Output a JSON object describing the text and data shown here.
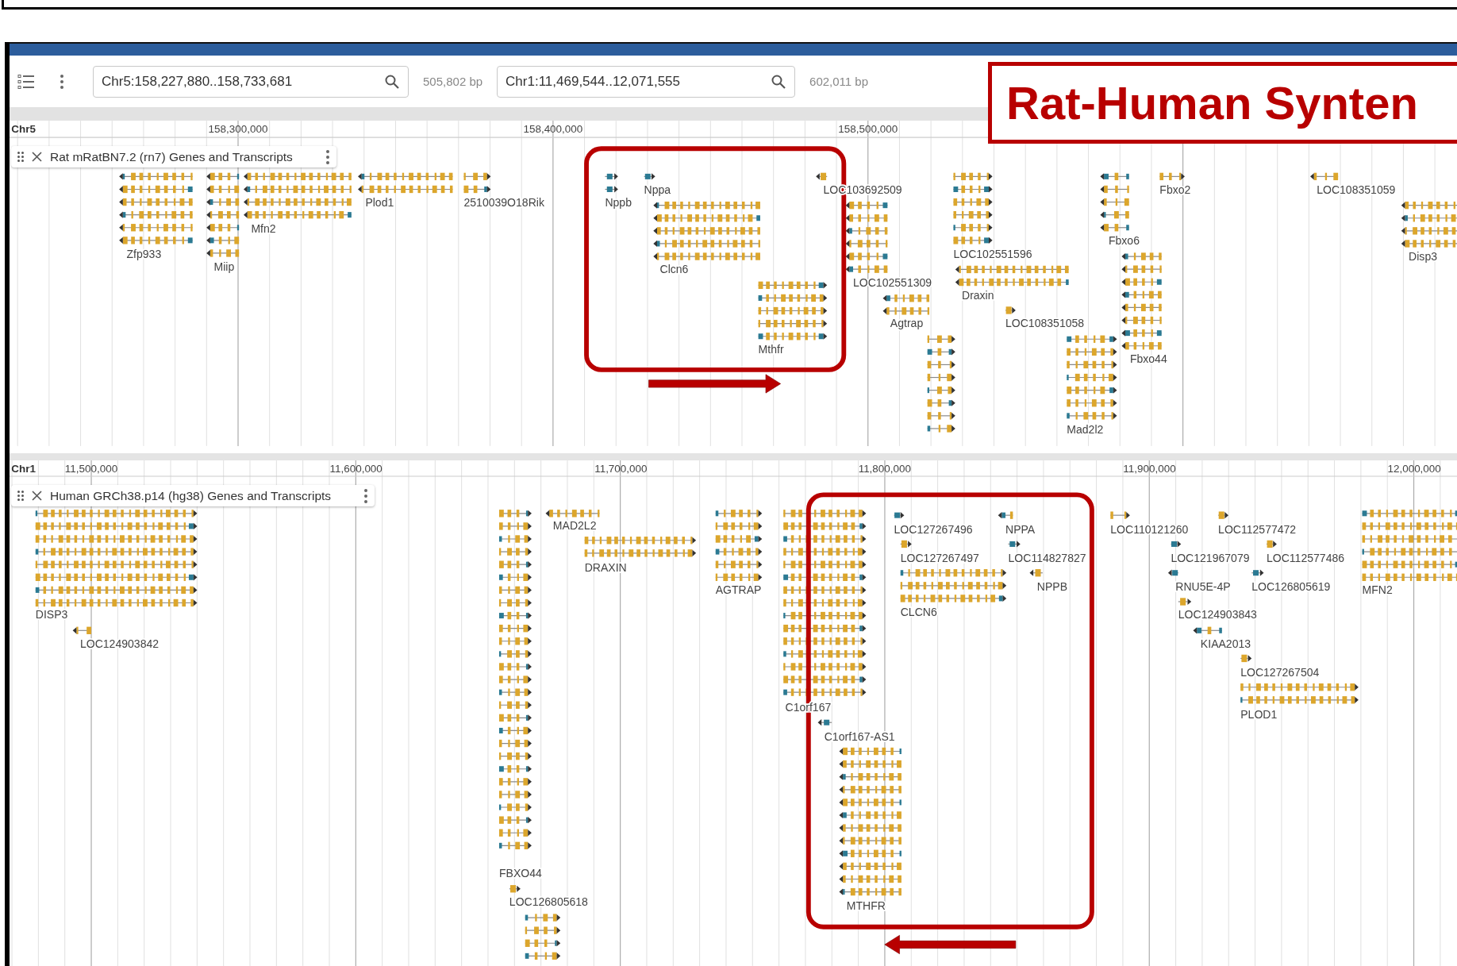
{
  "toolbar": {
    "views": [
      {
        "location": "Chr5:158,227,880..158,733,681",
        "span": "505,802 bp"
      },
      {
        "location": "Chr1:11,469,544..12,071,555",
        "span": "602,011 bp"
      }
    ]
  },
  "annotation_title": "Rat-Human Synten",
  "views": [
    {
      "chromosome": "Chr5",
      "ruler_labels": [
        "158,300,000",
        "158,400,000",
        "158,500,000"
      ],
      "track": {
        "title": "Rat mRatBN7.2 (rn7) Genes and Transcripts",
        "genes": [
          {
            "label": "Zfp933",
            "kind": "reverse"
          },
          {
            "label": "Miip",
            "kind": "reverse"
          },
          {
            "label": "Mfn2",
            "kind": "reverse"
          },
          {
            "label": "Plod1",
            "kind": "reverse"
          },
          {
            "label": "2510039O18Rik",
            "kind": "forward"
          },
          {
            "label": "Nppb",
            "kind": "forward"
          },
          {
            "label": "Nppa",
            "kind": "forward"
          },
          {
            "label": "LOC103692509",
            "kind": "reverse"
          },
          {
            "label": "LOC102551596",
            "kind": "forward"
          },
          {
            "label": "Fbxo6",
            "kind": "reverse"
          },
          {
            "label": "Fbxo2",
            "kind": "forward"
          },
          {
            "label": "LOC108351059",
            "kind": "reverse"
          },
          {
            "label": "Clcn6",
            "kind": "reverse"
          },
          {
            "label": "LOC102551309",
            "kind": "reverse"
          },
          {
            "label": "Disp3",
            "kind": "reverse"
          },
          {
            "label": "Fbxo44",
            "kind": "reverse"
          },
          {
            "label": "Draxin",
            "kind": "reverse"
          },
          {
            "label": "Mthfr",
            "kind": "forward"
          },
          {
            "label": "Agtrap",
            "kind": "reverse"
          },
          {
            "label": "LOC108351058",
            "kind": "forward"
          },
          {
            "kind": "forward"
          },
          {
            "label": "Mad2l2",
            "kind": "forward"
          }
        ]
      }
    },
    {
      "chromosome": "Chr1",
      "ruler_labels": [
        "11,500,000",
        "11,600,000",
        "11,700,000",
        "11,800,000",
        "11,900,000",
        "12,000,000"
      ],
      "track": {
        "title": "Human GRCh38.p14 (hg38) Genes and Transcripts",
        "genes": [
          {
            "label": "DISP3",
            "kind": "forward"
          },
          {
            "label": "FBXO44",
            "kind": "forward"
          },
          {
            "label": "MAD2L2",
            "kind": "reverse"
          },
          {
            "label": "AGTRAP",
            "kind": "forward"
          },
          {
            "label": "C1orf167",
            "kind": "forward"
          },
          {
            "label": "LOC127267496",
            "kind": "forward"
          },
          {
            "label": "NPPA",
            "kind": "reverse"
          },
          {
            "label": "LOC110121260",
            "kind": "forward"
          },
          {
            "label": "LOC112577472",
            "kind": "forward"
          },
          {
            "label": "MFN2",
            "kind": "forward"
          },
          {
            "label": "DRAXIN",
            "kind": "forward"
          },
          {
            "label": "LOC127267497",
            "kind": "forward"
          },
          {
            "label": "LOC114827827",
            "kind": "forward"
          },
          {
            "label": "LOC121967079",
            "kind": "forward"
          },
          {
            "label": "LOC112577486",
            "kind": "forward"
          },
          {
            "label": "CLCN6",
            "kind": "forward"
          },
          {
            "label": "NPPB",
            "kind": "reverse"
          },
          {
            "label": "RNU5E-4P",
            "kind": "reverse"
          },
          {
            "label": "LOC126805619",
            "kind": "forward"
          },
          {
            "label": "LOC124903843",
            "kind": "forward"
          },
          {
            "label": "LOC124903842",
            "kind": "reverse"
          },
          {
            "label": "KIAA2013",
            "kind": "reverse"
          },
          {
            "label": "LOC127267504",
            "kind": "forward"
          },
          {
            "label": "PLOD1",
            "kind": "forward"
          },
          {
            "label": "C1orf167-AS1",
            "kind": "reverse"
          },
          {
            "label": "MTHFR",
            "kind": "reverse"
          },
          {
            "label": "LOC126805618",
            "kind": "forward"
          },
          {
            "kind": "forward"
          }
        ]
      }
    }
  ]
}
